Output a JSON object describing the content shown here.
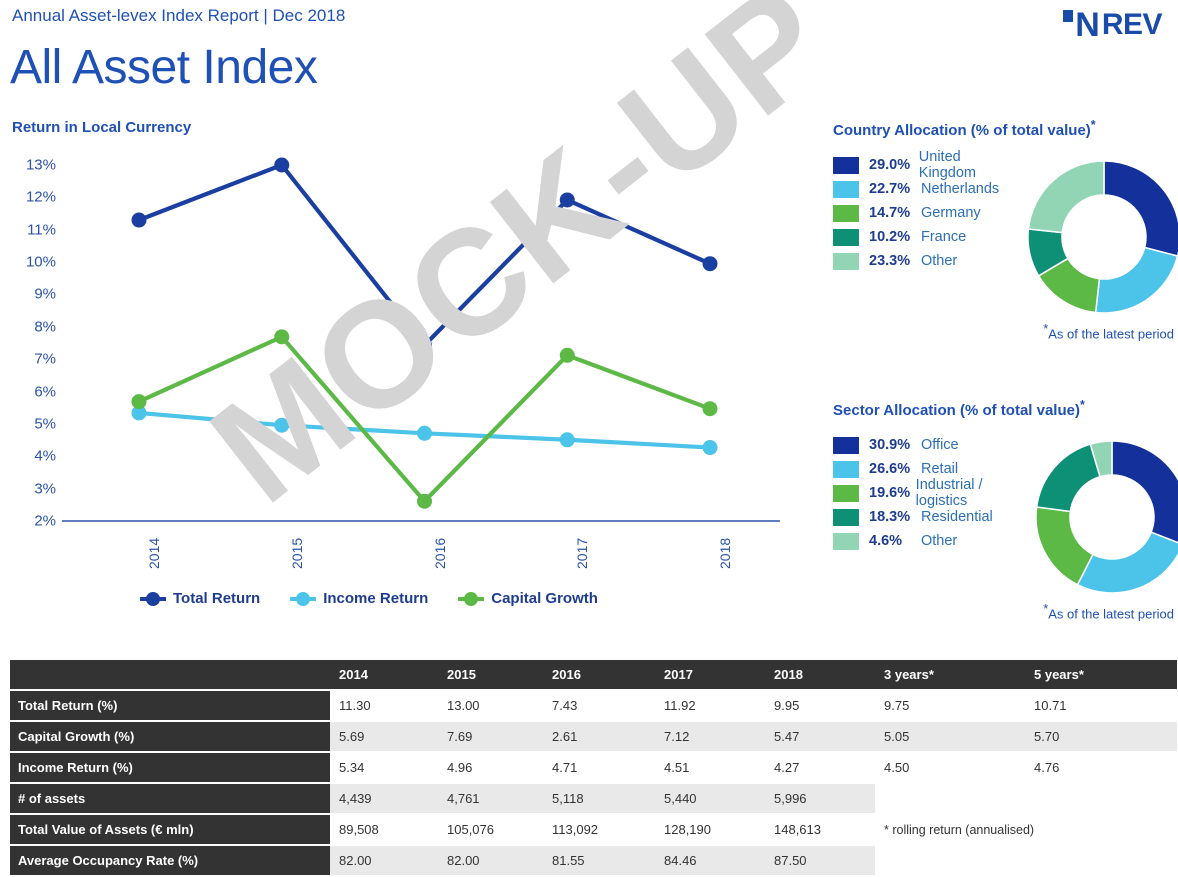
{
  "header": {
    "subtitle": "Annual Asset-levex Index Report | Dec 2018",
    "title": "All Asset Index",
    "logo_n": "N",
    "logo_rev": "REV"
  },
  "watermark": {
    "text": "MOCK-UP"
  },
  "chart": {
    "title": "Return in Local Currency",
    "legend": [
      {
        "label": "Total Return",
        "color": "#1b3fa0"
      },
      {
        "label": "Income Return",
        "color": "#4cc3e8"
      },
      {
        "label": "Capital Growth",
        "color": "#5cb946"
      }
    ]
  },
  "chart_data": {
    "type": "line",
    "title": "Return in Local Currency",
    "xlabel": "",
    "ylabel": "",
    "categories": [
      "2014",
      "2015",
      "2016",
      "2017",
      "2018"
    ],
    "yticks": [
      "13%",
      "12%",
      "11%",
      "10%",
      "9%",
      "8%",
      "7%",
      "6%",
      "5%",
      "4%",
      "3%",
      "2%"
    ],
    "ylim": [
      2,
      13
    ],
    "grid": false,
    "legend_position": "bottom",
    "series": [
      {
        "name": "Total Return",
        "color": "#1b3fa0",
        "values": [
          11.3,
          13.0,
          7.43,
          11.92,
          9.95
        ]
      },
      {
        "name": "Income Return",
        "color": "#4cc3e8",
        "values": [
          5.34,
          4.96,
          4.71,
          4.51,
          4.27
        ]
      },
      {
        "name": "Capital Growth",
        "color": "#5cb946",
        "values": [
          5.69,
          7.69,
          2.61,
          7.12,
          5.47
        ]
      }
    ]
  },
  "country_allocation": {
    "title": "Country Allocation (% of total value)",
    "title_star": "*",
    "note_star": "*",
    "note": "As of the latest period",
    "items": [
      {
        "pct": "29.0%",
        "name": "United Kingdom",
        "value": 29.0,
        "color": "#14309a"
      },
      {
        "pct": "22.7%",
        "name": "Netherlands",
        "value": 22.7,
        "color": "#4cc3e8"
      },
      {
        "pct": "14.7%",
        "name": "Germany",
        "value": 14.7,
        "color": "#5cb946"
      },
      {
        "pct": "10.2%",
        "name": "France",
        "value": 10.2,
        "color": "#0e9077"
      },
      {
        "pct": "23.3%",
        "name": "Other",
        "value": 23.3,
        "color": "#92d5b4"
      }
    ]
  },
  "sector_allocation": {
    "title": "Sector Allocation (% of total value)",
    "title_star": "*",
    "note_star": "*",
    "note": "As of the latest period",
    "items": [
      {
        "pct": "30.9%",
        "name": "Office",
        "value": 30.9,
        "color": "#14309a"
      },
      {
        "pct": "26.6%",
        "name": "Retail",
        "value": 26.6,
        "color": "#4cc3e8"
      },
      {
        "pct": "19.6%",
        "name": "Industrial / logistics",
        "value": 19.6,
        "color": "#5cb946"
      },
      {
        "pct": "18.3%",
        "name": "Residential",
        "value": 18.3,
        "color": "#0e9077"
      },
      {
        "pct": "4.6%",
        "name": "Other",
        "value": 4.6,
        "color": "#92d5b4"
      }
    ]
  },
  "table": {
    "columns": [
      "",
      "2014",
      "2015",
      "2016",
      "2017",
      "2018",
      "3 years*",
      "5 years*"
    ],
    "rows": [
      {
        "label": "Total Return (%)",
        "cells": [
          "11.30",
          "13.00",
          "7.43",
          "11.92",
          "9.95",
          "9.75",
          "10.71"
        ]
      },
      {
        "label": "Capital Growth (%)",
        "cells": [
          "5.69",
          "7.69",
          "2.61",
          "7.12",
          "5.47",
          "5.05",
          "5.70"
        ]
      },
      {
        "label": "Income Return (%)",
        "cells": [
          "5.34",
          "4.96",
          "4.71",
          "4.51",
          "4.27",
          "4.50",
          "4.76"
        ]
      },
      {
        "label": "# of assets",
        "cells": [
          "4,439",
          "4,761",
          "5,118",
          "5,440",
          "5,996",
          "",
          ""
        ]
      },
      {
        "label": "Total Value of Assets (€ mln)",
        "cells": [
          "89,508",
          "105,076",
          "113,092",
          "128,190",
          "148,613",
          "",
          ""
        ]
      },
      {
        "label": "Average Occupancy Rate (%)",
        "cells": [
          "82.00",
          "82.00",
          "81.55",
          "84.46",
          "87.50",
          "",
          ""
        ]
      }
    ],
    "footnote": "* rolling return (annualised)"
  }
}
